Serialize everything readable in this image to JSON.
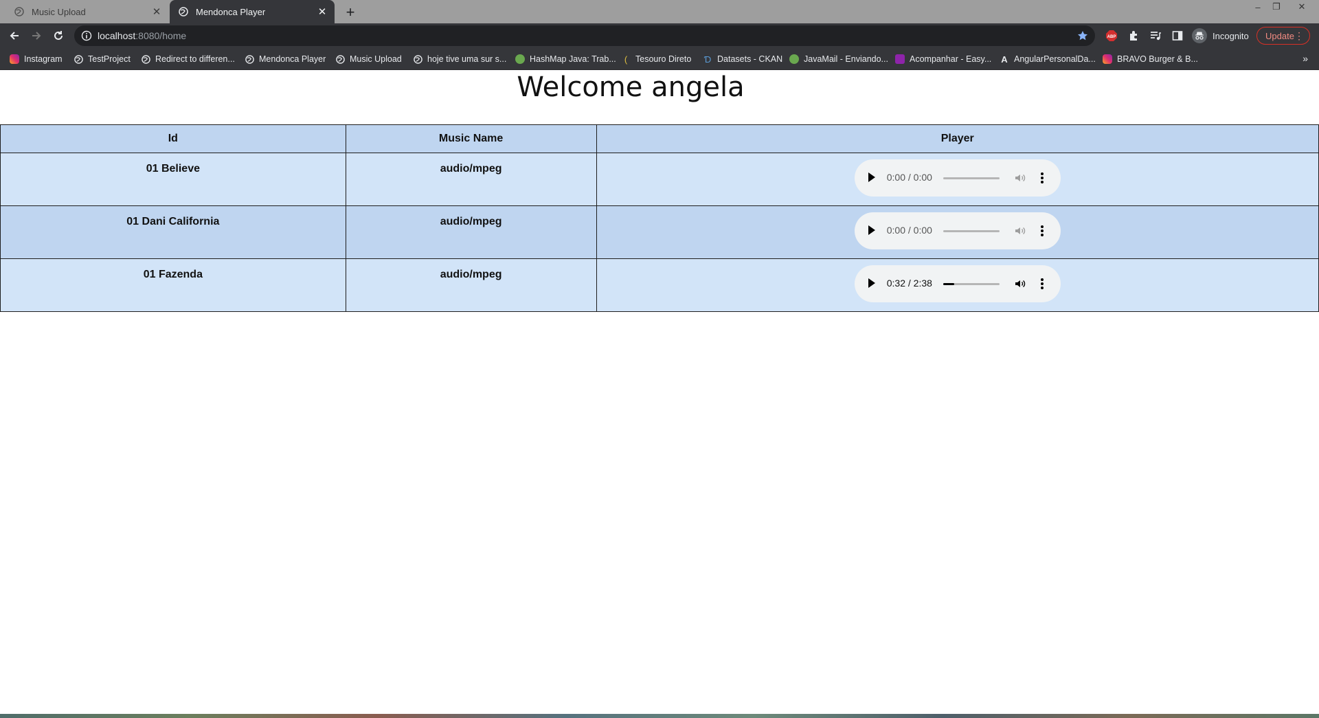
{
  "browser": {
    "tabs": [
      {
        "title": "Music Upload",
        "active": false
      },
      {
        "title": "Mendonca Player",
        "active": true
      }
    ],
    "address": {
      "host": "localhost",
      "path": ":8080/home"
    },
    "profile_label": "Incognito",
    "update_label": "Update",
    "bookmarks": [
      {
        "label": "Instagram",
        "icon": "instagram-icon",
        "color": "#e1306c"
      },
      {
        "label": "TestProject",
        "icon": "globe-icon",
        "color": "#e8eaed"
      },
      {
        "label": "Redirect to differen...",
        "icon": "globe-icon",
        "color": "#e8eaed"
      },
      {
        "label": "Mendonca Player",
        "icon": "globe-icon",
        "color": "#e8eaed"
      },
      {
        "label": "Music Upload",
        "icon": "globe-icon",
        "color": "#e8eaed"
      },
      {
        "label": "hoje tive uma sur s...",
        "icon": "globe-icon",
        "color": "#e8eaed"
      },
      {
        "label": "HashMap Java: Trab...",
        "icon": "green-globe-icon",
        "color": "#6aa84f"
      },
      {
        "label": "Tesouro Direto",
        "icon": "tesouro-icon",
        "color": "#e0c040"
      },
      {
        "label": "Datasets - CKAN",
        "icon": "ckan-icon",
        "color": "#5b9bd5"
      },
      {
        "label": "JavaMail - Enviando...",
        "icon": "green-globe-icon",
        "color": "#6aa84f"
      },
      {
        "label": "Acompanhar - Easy...",
        "icon": "easy-icon",
        "color": "#8e24aa"
      },
      {
        "label": "AngularPersonalDa...",
        "icon": "angular-icon",
        "color": "#e8eaed"
      },
      {
        "label": "BRAVO Burger & B...",
        "icon": "instagram-icon",
        "color": "#e1306c"
      }
    ]
  },
  "page": {
    "heading": "Welcome angela",
    "table": {
      "headers": [
        "Id",
        "Music Name",
        "Player"
      ],
      "rows": [
        {
          "id": "01 Believe",
          "music_name": "audio/mpeg",
          "time": "0:00 / 0:00",
          "progress": 0,
          "muted_look": true
        },
        {
          "id": "01 Dani California",
          "music_name": "audio/mpeg",
          "time": "0:00 / 0:00",
          "progress": 0,
          "muted_look": true
        },
        {
          "id": "01 Fazenda",
          "music_name": "audio/mpeg",
          "time": "0:32 / 2:38",
          "progress": 0.2,
          "muted_look": false
        }
      ]
    }
  }
}
